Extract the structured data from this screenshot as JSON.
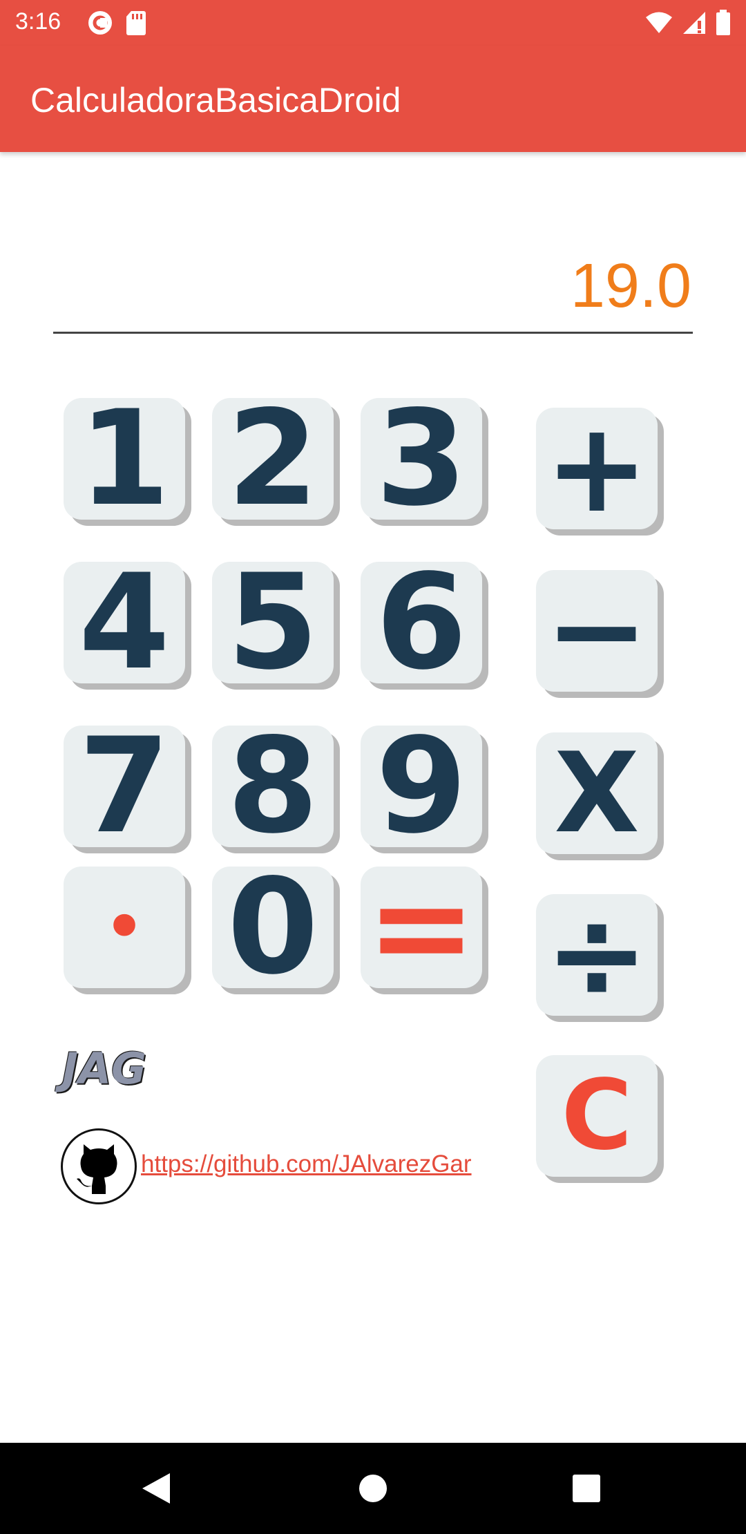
{
  "status_bar": {
    "time": "3:16",
    "left_icons": [
      "pocket-casts-icon",
      "sd-card-icon"
    ],
    "right_icons": [
      "wifi-icon",
      "signal-icon",
      "battery-icon"
    ]
  },
  "app_bar": {
    "title": "CalculadoraBasicaDroid"
  },
  "display": {
    "value": "19.0"
  },
  "keypad": {
    "digits": [
      "1",
      "2",
      "3",
      "4",
      "5",
      "6",
      "7",
      "8",
      "9",
      "0"
    ],
    "decimal": "•",
    "equals": "=",
    "operators": {
      "add": "+",
      "subtract": "−",
      "multiply": "X",
      "divide": "÷",
      "clear": "C"
    }
  },
  "footer": {
    "logo_text": "JAG",
    "link": "https://github.com/JAlvarezGar"
  },
  "nav_bar": {
    "buttons": [
      "back",
      "home",
      "recents"
    ]
  },
  "colors": {
    "primary": "#e74f42",
    "display_text": "#f07d1a",
    "key_text": "#1d3a50",
    "key_accent": "#f04a36",
    "key_face": "#eaeff0"
  }
}
